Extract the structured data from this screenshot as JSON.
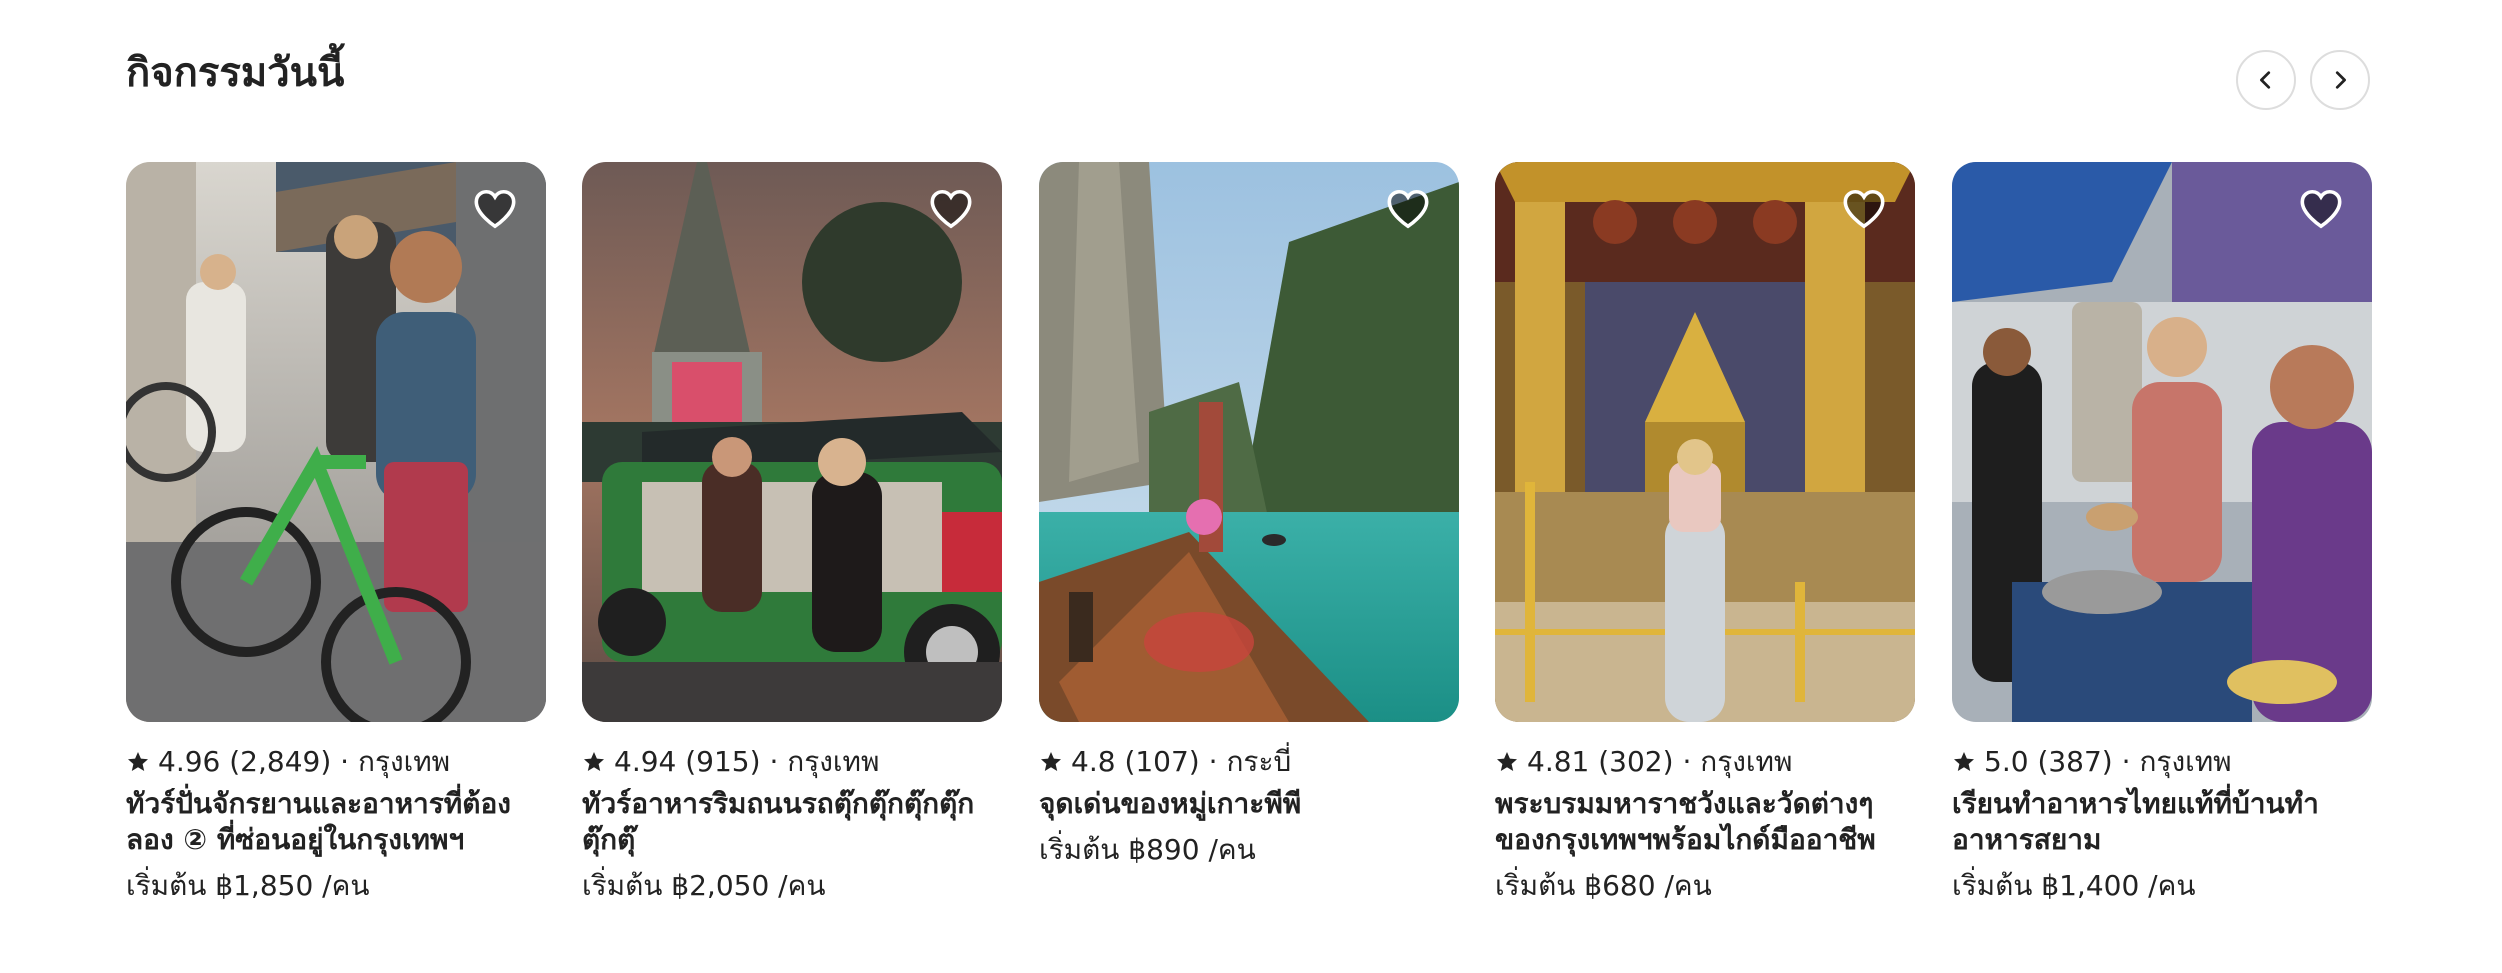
{
  "section": {
    "title": "กิจกรรมวันนี้"
  },
  "nav": {
    "prev_icon": "chevron-left-icon",
    "next_icon": "chevron-right-icon"
  },
  "cards": [
    {
      "rating": "4.96",
      "reviews": "(2,849)",
      "separator": "·",
      "location": "กรุงเทพ",
      "title": "ทัวร์ปั่นจักรยานและอาหารที่ต้องลอง ② ที่ซ่อนอยู่ในกรุงเทพฯ",
      "price": "เริ่มต้น ฿1,850 /คน",
      "image": "cyclists-on-bangkok-street"
    },
    {
      "rating": "4.94",
      "reviews": "(915)",
      "separator": "·",
      "location": "กรุงเทพ",
      "title": "ทัวร์อาหารริมถนนรถตุ๊กตุ๊กตุ๊กตุ๊กตุ๊กตุ๊",
      "price": "เริ่มต้น ฿2,050 /คน",
      "image": "tuk-tuk-at-night-temple"
    },
    {
      "rating": "4.8",
      "reviews": "(107)",
      "separator": "·",
      "location": "กระบี่",
      "title": "จุดเด่นของหมู่เกาะพีพี",
      "price": "เริ่มต้น ฿890 /คน",
      "image": "longtail-boat-phi-phi"
    },
    {
      "rating": "4.81",
      "reviews": "(302)",
      "separator": "·",
      "location": "กรุงเทพ",
      "title": "พระบรมมหาราชวังและวัดต่างๆของกรุงเทพฯพร้อมไกด์มืออาชีพ",
      "price": "เริ่มต้น ฿680 /คน",
      "image": "grand-palace-golden-temple"
    },
    {
      "rating": "5.0",
      "reviews": "(387)",
      "separator": "·",
      "location": "กรุงเทพ",
      "title": "เรียนทำอาหารไทยแท้ที่บ้านทำอาหารสยาม",
      "price": "เริ่มต้น ฿1,400 /คน",
      "image": "thai-cooking-class"
    }
  ],
  "colors": {
    "text": "#222222",
    "border": "#dddddd",
    "heart_stroke": "#ffffff"
  }
}
